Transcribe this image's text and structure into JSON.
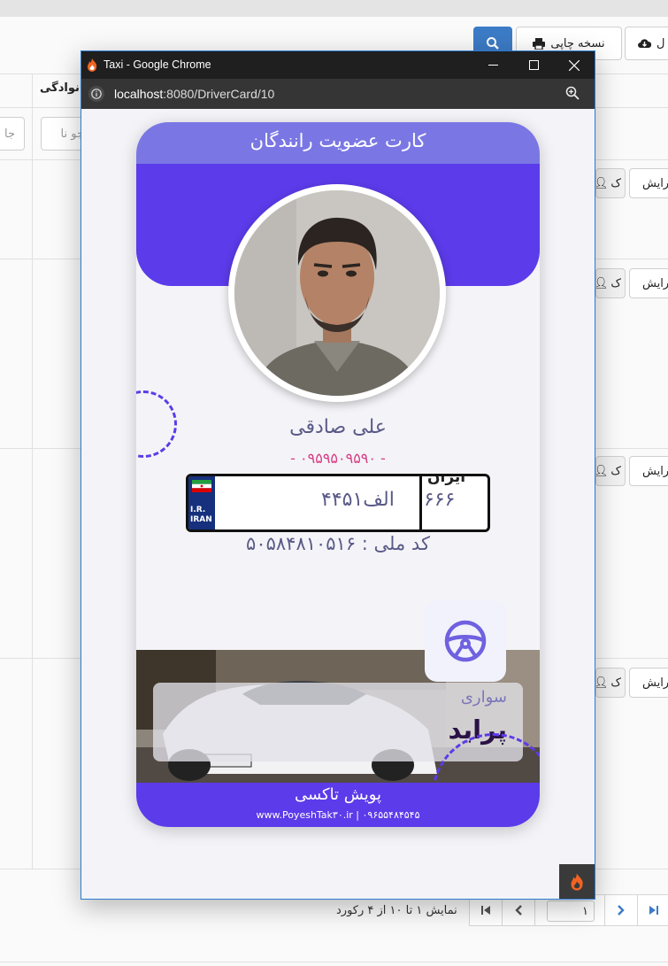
{
  "background_app": {
    "toolbar": {
      "print_label": "نسخه چاپی",
      "excel_label": "ل"
    },
    "table": {
      "column_header": "خانوادگی",
      "filter_placeholder_1": "جو نا",
      "filter_placeholder_2": "جا"
    },
    "rows": [
      {
        "edit_label": "رایش",
        "user_label": "ک"
      },
      {
        "edit_label": "رایش",
        "user_label": "ک"
      },
      {
        "edit_label": "رایش",
        "user_label": "ک"
      },
      {
        "edit_label": "رایش",
        "user_label": "ک"
      }
    ],
    "pagination": {
      "info": "نمایش ۱ تا ۱۰ از ۴ رکورد",
      "current_page": "۱"
    }
  },
  "popup": {
    "window_title": "Taxi - Google Chrome",
    "url_host": "localhost",
    "url_path": ":8080/DriverCard/10",
    "card": {
      "title": "کارت عضویت رانندگان",
      "driver_name": "علی صادقی",
      "phone": "- ۰۹۵۹۵۰۹۵۹۰ -",
      "plate": {
        "country": "I.R.\nIRAN",
        "number": "۴۴الف۵۱",
        "iran_label": "ایران",
        "region_code": "۶۶۶"
      },
      "national_id": "کد ملی : ۵۰۵۸۴۸۱۰۵۱۶",
      "vehicle_type": "سواری",
      "vehicle_model": "پراید",
      "footer_name": "پویش تاکسی",
      "footer_site": "www.PoyeshTak۳۰.ir | ۰۹۶۵۵۴۸۴۵۴۵"
    }
  },
  "colors": {
    "header_accent": "#7a77e4",
    "primary_purple": "#5c3bea",
    "phone_pink": "#d63f83",
    "text_muted": "#5a5a88",
    "bg_button_blue": "#3c7bc6"
  }
}
